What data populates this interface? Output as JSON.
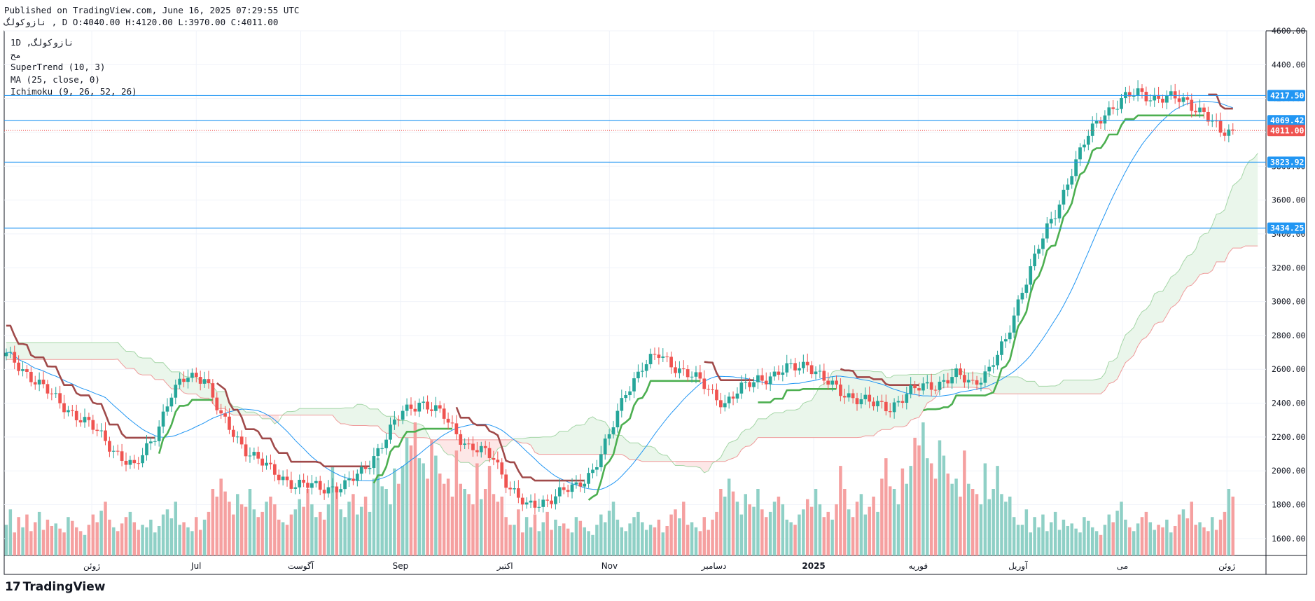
{
  "header": {
    "published": "Published on TradingView.com, June 16, 2025 07:29:55 UTC",
    "ohlc_line": "نازوکولگ , D O:4040.00 H:4120.00 L:3970.00 C:4011.00"
  },
  "legend": {
    "symbol": "1D ,نازوکولگ",
    "symbol_line2": "مح",
    "indicators": [
      "SuperTrend (10, 3)",
      "MA (25, close, 0)",
      "Ichimoku (9, 26, 52, 26)"
    ]
  },
  "brand": {
    "mark": "17",
    "name": "TradingView"
  },
  "colors": {
    "up": "#26a69a",
    "down": "#ef5350",
    "vol_up": "#8fd0c6",
    "vol_down": "#f5a0a0",
    "supertrend_up": "#4caf50",
    "supertrend_down": "#a04a4a",
    "ma": "#2196f3",
    "level": "#2196f3",
    "kumo_bull": "#e8f5e9",
    "kumo_bear": "#fde4e4"
  },
  "chart_data": {
    "type": "candlestick",
    "title": "",
    "y_axis": {
      "min": 1500,
      "max": 4600,
      "ticks": [
        "4600.00",
        "4400.00",
        "4200.00",
        "4000.00",
        "3800.00",
        "3600.00",
        "3400.00",
        "3200.00",
        "3000.00",
        "2800.00",
        "2600.00",
        "2400.00",
        "2200.00",
        "2000.00",
        "1800.00",
        "1600.00"
      ]
    },
    "x_axis": {
      "labels": [
        {
          "label": "ژوئن",
          "date": "2024-06"
        },
        {
          "label": "Jul",
          "date": "2024-07"
        },
        {
          "label": "آگوست",
          "date": "2024-08"
        },
        {
          "label": "Sep",
          "date": "2024-09"
        },
        {
          "label": "اکتبر",
          "date": "2024-10"
        },
        {
          "label": "Nov",
          "date": "2024-11"
        },
        {
          "label": "دسامبر",
          "date": "2024-12"
        },
        {
          "label": "2025",
          "date": "2025-01"
        },
        {
          "label": "فوریه",
          "date": "2025-02"
        },
        {
          "label": "آوریل",
          "date": "2025-04"
        },
        {
          "label": "می",
          "date": "2025-05"
        },
        {
          "label": "ژوئن",
          "date": "2025-06"
        }
      ]
    },
    "horizontal_levels": [
      {
        "value": 4217.5,
        "label": "4217.50"
      },
      {
        "value": 4069.42,
        "label": "4069.42"
      },
      {
        "value": 3823.92,
        "label": "3823.92"
      },
      {
        "value": 3434.25,
        "label": "3434.25"
      }
    ],
    "last_price": {
      "value": 4011.0,
      "label": "4011.00"
    },
    "close_path": [
      [
        0,
        2680
      ],
      [
        6,
        2560
      ],
      [
        12,
        2420
      ],
      [
        18,
        2310
      ],
      [
        22,
        2230
      ],
      [
        28,
        2080
      ],
      [
        31,
        2010
      ],
      [
        36,
        2220
      ],
      [
        40,
        2450
      ],
      [
        44,
        2560
      ],
      [
        48,
        2560
      ],
      [
        52,
        2310
      ],
      [
        58,
        2130
      ],
      [
        64,
        2000
      ],
      [
        70,
        1920
      ],
      [
        76,
        1900
      ],
      [
        82,
        1910
      ],
      [
        86,
        1990
      ],
      [
        91,
        2160
      ],
      [
        96,
        2350
      ],
      [
        100,
        2410
      ],
      [
        106,
        2320
      ],
      [
        112,
        2140
      ],
      [
        118,
        2080
      ],
      [
        122,
        1900
      ],
      [
        126,
        1780
      ],
      [
        130,
        1820
      ],
      [
        134,
        1870
      ],
      [
        138,
        1900
      ],
      [
        142,
        2010
      ],
      [
        146,
        2200
      ],
      [
        150,
        2470
      ],
      [
        154,
        2620
      ],
      [
        158,
        2680
      ],
      [
        162,
        2620
      ],
      [
        166,
        2560
      ],
      [
        170,
        2480
      ],
      [
        174,
        2400
      ],
      [
        178,
        2480
      ],
      [
        182,
        2550
      ],
      [
        186,
        2560
      ],
      [
        190,
        2610
      ],
      [
        194,
        2640
      ],
      [
        198,
        2530
      ],
      [
        202,
        2470
      ],
      [
        206,
        2430
      ],
      [
        210,
        2390
      ],
      [
        214,
        2380
      ],
      [
        218,
        2450
      ],
      [
        222,
        2500
      ],
      [
        226,
        2520
      ],
      [
        230,
        2560
      ],
      [
        234,
        2520
      ],
      [
        238,
        2600
      ],
      [
        242,
        2760
      ],
      [
        246,
        3080
      ],
      [
        250,
        3320
      ],
      [
        254,
        3520
      ],
      [
        258,
        3780
      ],
      [
        262,
        3980
      ],
      [
        266,
        4120
      ],
      [
        270,
        4190
      ],
      [
        274,
        4230
      ],
      [
        278,
        4210
      ],
      [
        282,
        4200
      ],
      [
        286,
        4180
      ],
      [
        290,
        4120
      ],
      [
        294,
        3990
      ],
      [
        297,
        4011
      ]
    ],
    "volume": [
      120,
      180,
      90,
      150,
      110,
      160,
      95,
      130,
      170,
      100,
      140,
      115,
      125,
      105,
      90,
      150,
      135,
      110,
      95,
      80,
      120,
      160,
      130,
      175,
      210,
      140,
      110,
      95,
      125,
      150,
      170,
      130,
      100,
      120,
      110,
      140,
      90,
      115,
      160,
      180,
      145,
      210,
      120,
      130,
      110,
      95,
      150,
      100,
      140,
      170,
      260,
      230,
      300,
      250,
      210,
      160,
      240,
      200,
      190,
      260,
      180,
      150,
      170,
      210,
      230,
      200,
      140,
      130,
      120,
      160,
      180,
      220,
      190,
      260,
      200,
      150,
      170,
      140,
      200,
      350,
      260,
      180,
      150,
      210,
      240,
      160,
      190,
      230,
      170,
      300,
      380,
      270,
      260,
      200,
      340,
      280,
      350,
      460,
      430,
      520,
      380,
      360,
      300,
      450,
      390,
      320,
      280,
      300,
      230,
      410,
      280,
      260,
      240,
      200,
      360,
      220,
      260,
      350,
      240,
      210,
      230,
      150,
      120
    ],
    "volume_units": "relative (no scale shown)"
  }
}
